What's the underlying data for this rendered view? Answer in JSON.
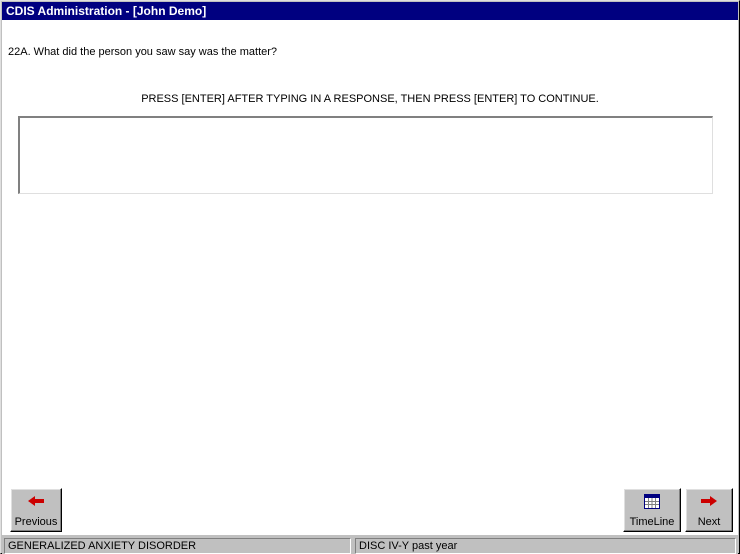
{
  "window": {
    "title": "CDIS Administration - [John Demo]"
  },
  "question": {
    "text": "22A. What did the person you saw say was the matter?"
  },
  "instruction": {
    "text": "PRESS [ENTER] AFTER TYPING IN A RESPONSE, THEN PRESS [ENTER] TO CONTINUE."
  },
  "response": {
    "value": ""
  },
  "buttons": {
    "previous": {
      "label": "Previous",
      "icon": "arrow-left-icon"
    },
    "timeline": {
      "label": "TimeLine",
      "icon": "calendar-icon"
    },
    "next": {
      "label": "Next",
      "icon": "arrow-right-icon"
    }
  },
  "status": {
    "module": "GENERALIZED ANXIETY DISORDER",
    "version": "DISC IV-Y past year"
  },
  "colors": {
    "titlebar": "#000080",
    "arrow": "#cc0000"
  }
}
